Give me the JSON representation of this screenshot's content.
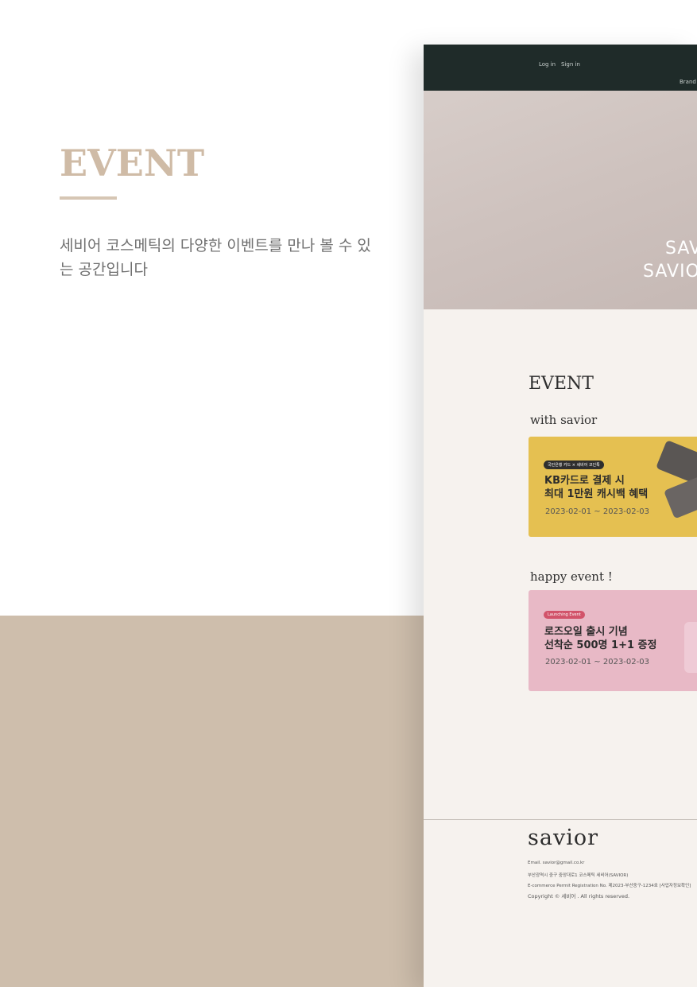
{
  "intro": {
    "title": "EVENT",
    "description": "세비어 코스메틱의 다양한 이벤트를 만나 볼 수 있는 공간입니다"
  },
  "header": {
    "login": "Log in",
    "signin": "Sign in",
    "brand": "Brand"
  },
  "hero": {
    "line1": "SAV",
    "line2": "SAVIO"
  },
  "event_section": {
    "title": "EVENT",
    "sub1": "with savior",
    "sub2": "happy event !"
  },
  "cards": [
    {
      "badge": "국민은행 카드 × 세비어 코인톡",
      "headline1": "KB카드로 결제 시",
      "headline2": "최대 1만원 캐시백 혜택",
      "period": "2023-02-01 ~ 2023-02-03"
    },
    {
      "badge": "Launching Event",
      "headline1": "로즈오일 출시 기념",
      "headline2": "선착순 500명 1+1 증정",
      "period": "2023-02-01 ~ 2023-02-03"
    }
  ],
  "footer": {
    "logo": "savior",
    "email": "Email. savior@gmail.co.kr",
    "address": "부산광역시 중구 중앙대로1 코스메틱 세비어(SAVIOR)",
    "permit": "E-commerce Permit Registration No. 제2023-부산중구-1234호 [사업자정보확인]",
    "copyright": "Copyright © 세비어 . All rights reserved."
  },
  "colors": {
    "accent_tan": "#cebeac",
    "header_dark": "#1f2b29",
    "card_yellow": "#e5c051",
    "card_pink": "#e8b9c6"
  }
}
